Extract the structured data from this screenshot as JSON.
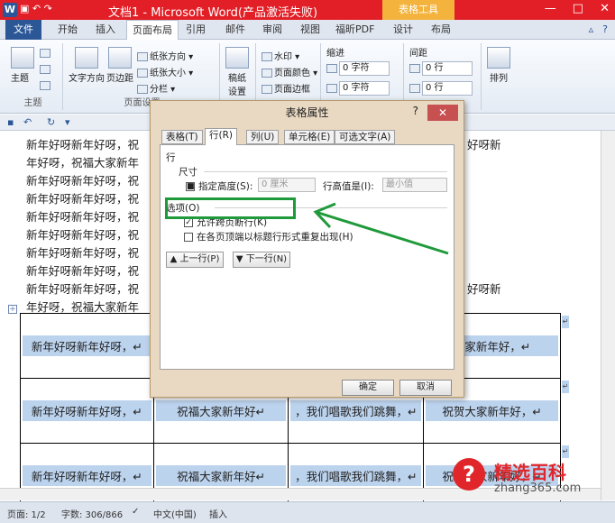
{
  "titlebar": {
    "word_icon": "W",
    "title": "文档1 - Microsoft Word(产品激活失败)",
    "tool_group": "表格工具",
    "controls": [
      "—",
      "□",
      "✕"
    ]
  },
  "tabs": [
    "文件",
    "开始",
    "插入",
    "页面布局",
    "引用",
    "邮件",
    "审阅",
    "视图",
    "福昕PDF",
    "设计",
    "布局"
  ],
  "ribbon": {
    "theme": {
      "btn": "主题",
      "label": "主题"
    },
    "page_setup": {
      "text_dir": "文字方向",
      "margins": "页边距",
      "orientation": "纸张方向",
      "size": "纸张大小",
      "columns": "分栏",
      "label": "页面设置"
    },
    "paper": {
      "btn1": "稿纸",
      "btn2": "设置"
    },
    "background": {
      "watermark": "水印",
      "page_color": "页面颜色",
      "page_border": "页面边框"
    },
    "indent": {
      "label": "缩进",
      "left": "0 字符",
      "right": "0 字符"
    },
    "spacing": {
      "label": "间距",
      "before": "0 行",
      "after": "0 行"
    },
    "arrange": {
      "btn": "排列"
    }
  },
  "document": {
    "lines": [
      "新年好呀新年好呀，祝",
      "年好呀，祝福大家新年",
      "新年好呀新年好呀，祝",
      "新年好呀新年好呀，祝",
      "新年好呀新年好呀，祝",
      "新年好呀新年好呀，祝",
      "新年好呀新年好呀，祝",
      "新年好呀新年好呀，祝",
      "新年好呀新年好呀，祝",
      "年好呀，祝福大家新年"
    ],
    "right_fragments": [
      "好呀新",
      "好呀新"
    ],
    "table_rows": [
      [
        "新年好呀新年好呀，↵",
        "",
        "",
        "大家新年好，↵"
      ],
      [
        "新年好呀新年好呀，↵",
        "祝福大家新年好↵",
        "，我们唱歌我们跳舞，↵",
        "祝贺大家新年好，↵"
      ],
      [
        "新年好呀新年好呀，↵",
        "祝福大家新年好↵",
        "，我们唱歌我们跳舞，↵",
        "祝贺大家新年好，↵"
      ]
    ]
  },
  "dialog": {
    "title": "表格属性",
    "help": "?",
    "close": "✕",
    "tabs": [
      "表格(T)",
      "行(R)",
      "列(U)",
      "单元格(E)",
      "可选文字(A)"
    ],
    "section": "行",
    "size_label": "尺寸",
    "height_check": "指定高度(S):",
    "height_value": "0 厘米",
    "height_rule_label": "行高值是(I):",
    "height_rule_value": "最小值",
    "options_label": "选项(O)",
    "allow_break": "允许跨页断行(K)",
    "repeat_header": "在各页顶端以标题行形式重复出现(H)",
    "prev_row": "▲ 上一行(P)",
    "next_row": "▼ 下一行(N)",
    "ok": "确定",
    "cancel": "取消"
  },
  "statusbar": {
    "page": "页面: 1/2",
    "words": "字数: 306/866",
    "lang": "中文(中国)",
    "mode": "插入"
  },
  "watermark": {
    "icon": "?",
    "title": "精选百科",
    "url": "zhang365.com"
  },
  "colors": {
    "title_red": "#e21f26",
    "tool_orange": "#f3b33d",
    "highlight": "#bcd3ee",
    "annotation_green": "#1f9a3a"
  }
}
